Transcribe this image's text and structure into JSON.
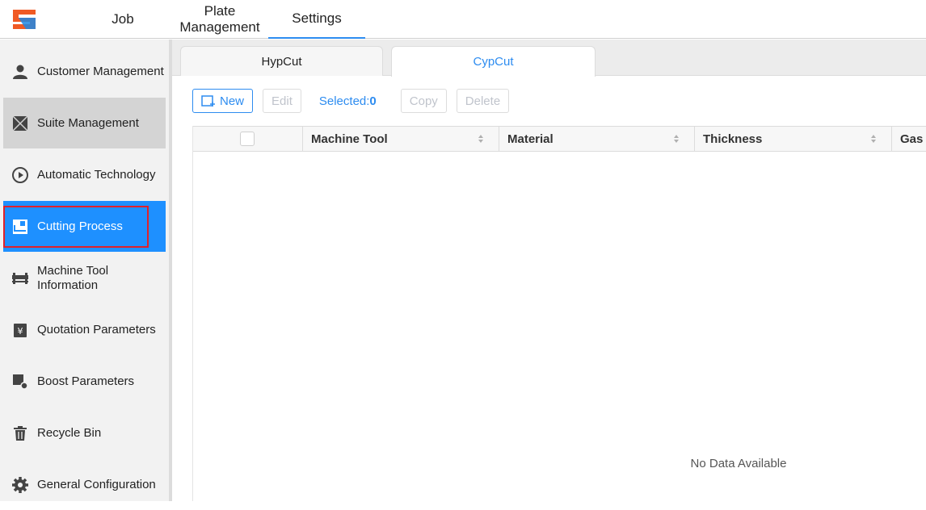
{
  "topnav": {
    "tabs": [
      {
        "label": "Job"
      },
      {
        "label": "Plate\nManagement"
      },
      {
        "label": "Settings"
      }
    ],
    "active_tab": "Settings"
  },
  "sidebar": {
    "items": [
      {
        "label": "Customer Management",
        "icon": "person-icon"
      },
      {
        "label": "Suite Management",
        "icon": "suite-icon"
      },
      {
        "label": "Automatic Technology",
        "icon": "play-circle-icon"
      },
      {
        "label": "Cutting Process",
        "icon": "cutting-process-icon"
      },
      {
        "label": "Machine Tool Information",
        "icon": "machine-bed-icon"
      },
      {
        "label": "Quotation Parameters",
        "icon": "yen-document-icon"
      },
      {
        "label": "Boost Parameters",
        "icon": "boost-gear-icon"
      },
      {
        "label": "Recycle Bin",
        "icon": "trash-icon"
      },
      {
        "label": "General Configuration",
        "icon": "gear-icon"
      }
    ],
    "active_item": "Cutting Process",
    "hover_item": "Suite Management"
  },
  "subtabs": [
    {
      "label": "HypCut"
    },
    {
      "label": "CypCut"
    }
  ],
  "active_subtab": "CypCut",
  "toolbar": {
    "new_label": "New",
    "edit_label": "Edit",
    "selected_label": "Selected:",
    "selected_count": "0",
    "copy_label": "Copy",
    "delete_label": "Delete"
  },
  "table": {
    "columns": [
      "Machine Tool",
      "Material",
      "Thickness",
      "Gas"
    ],
    "rows": [],
    "empty_text": "No Data Available"
  },
  "colors": {
    "accent": "#2d8cf0",
    "active_sidebar": "#1e90ff",
    "highlight": "#e0212b"
  }
}
